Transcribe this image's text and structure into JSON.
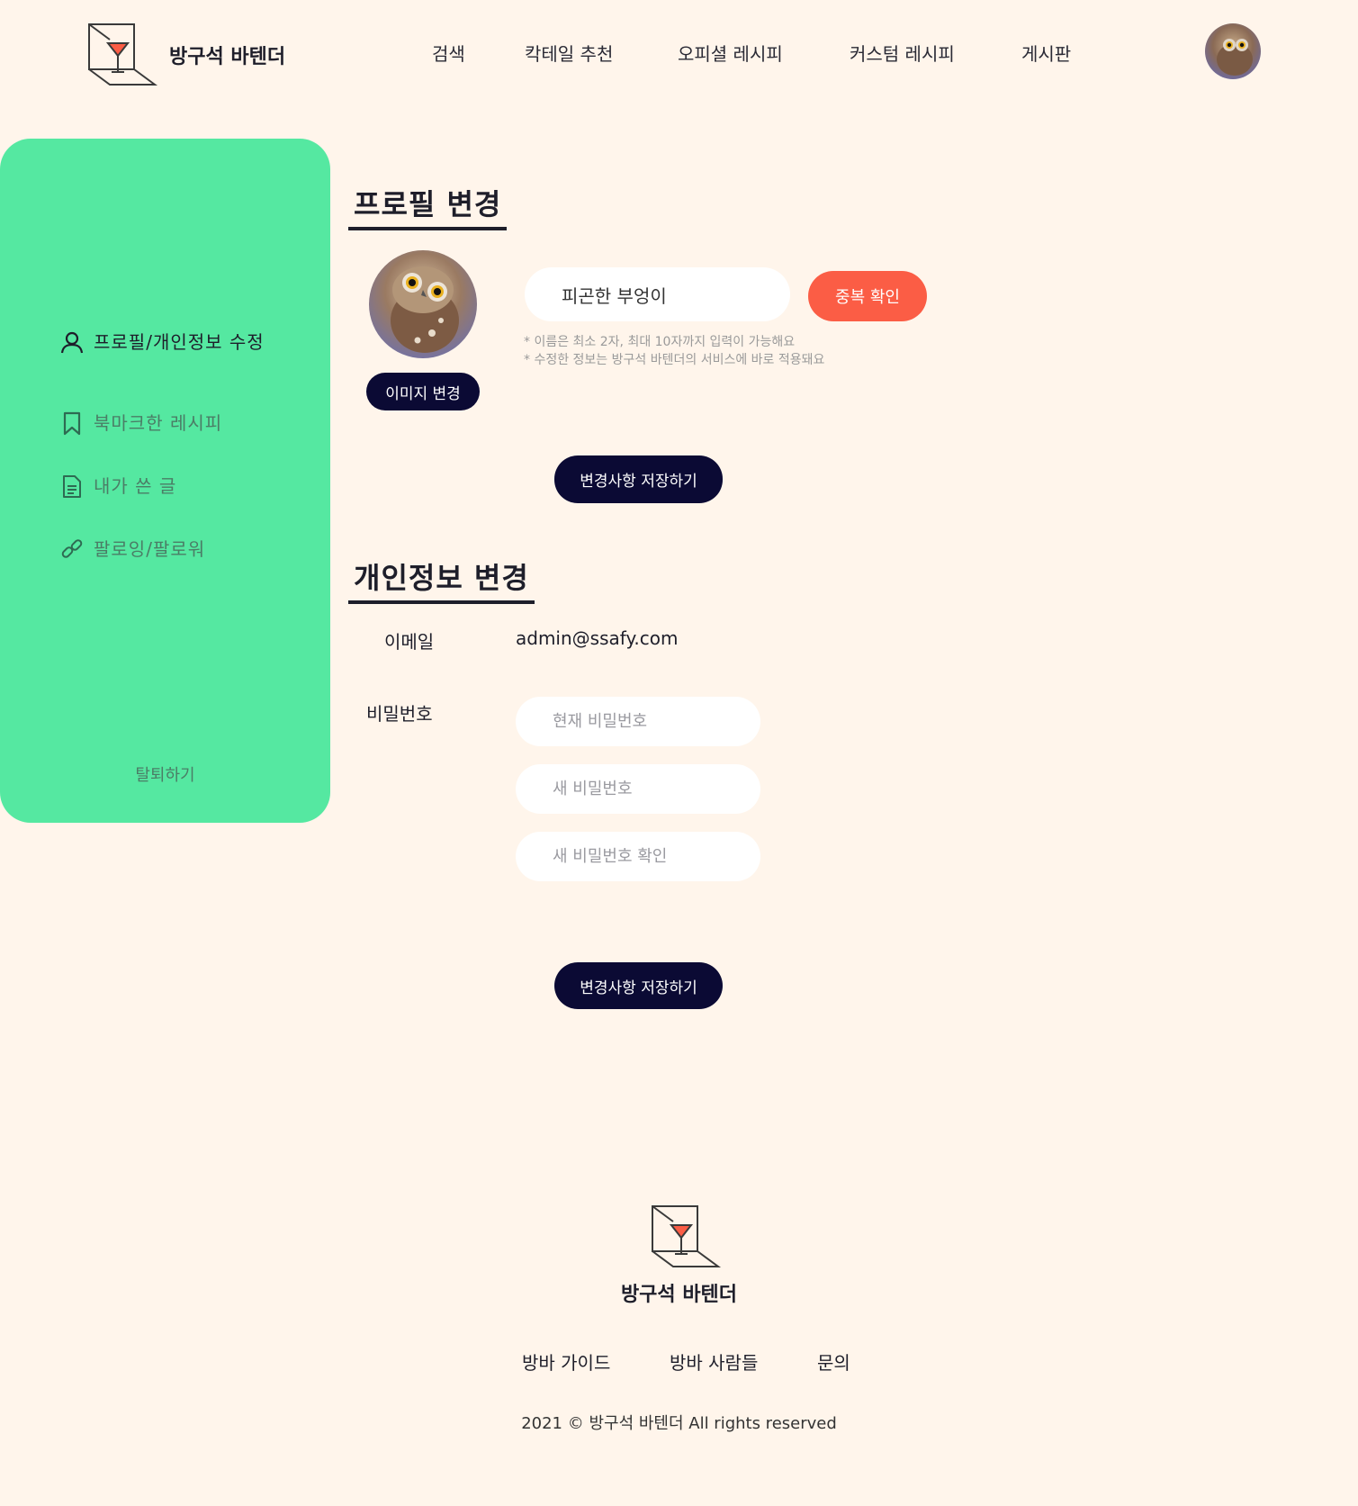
{
  "header": {
    "logo_text": "방구석 바텐더",
    "nav": [
      "검색",
      "칵테일 추천",
      "오피셜 레시피",
      "커스텀 레시피",
      "게시판"
    ]
  },
  "sidebar": {
    "items": [
      {
        "label": "프로필/개인정보 수정",
        "icon": "user-icon",
        "active": true
      },
      {
        "label": "북마크한 레시피",
        "icon": "bookmark-icon",
        "active": false
      },
      {
        "label": "내가 쓴 글",
        "icon": "document-icon",
        "active": false
      },
      {
        "label": "팔로잉/팔로워",
        "icon": "link-icon",
        "active": false
      }
    ],
    "withdraw_label": "탈퇴하기"
  },
  "profile": {
    "title": "프로필 변경",
    "image_button": "이미지 변경",
    "nickname_value": "피곤한 부엉이",
    "check_button": "중복 확인",
    "hints": [
      "* 이름은 최소 2자, 최대 10자까지 입력이 가능해요",
      "* 수정한 정보는 방구석 바텐더의 서비스에 바로 적용돼요"
    ],
    "save_button": "변경사항 저장하기"
  },
  "personal": {
    "title": "개인정보 변경",
    "email_label": "이메일",
    "email_value": "admin@ssafy.com",
    "password_label": "비밀번호",
    "current_pw_placeholder": "현재 비밀번호",
    "new_pw_placeholder": "새 비밀번호",
    "confirm_pw_placeholder": "새 비밀번호 확인",
    "save_button": "변경사항 저장하기"
  },
  "footer": {
    "title": "방구석 바텐더",
    "links": [
      "방바 가이드",
      "방바 사람들",
      "문의"
    ],
    "copyright": "2021 © 방구석 바텐더 All rights reserved"
  },
  "colors": {
    "background": "#fff5eb",
    "sidebar": "#55e8a1",
    "primary_dark": "#0b0a34",
    "accent_red": "#fb5d45"
  }
}
